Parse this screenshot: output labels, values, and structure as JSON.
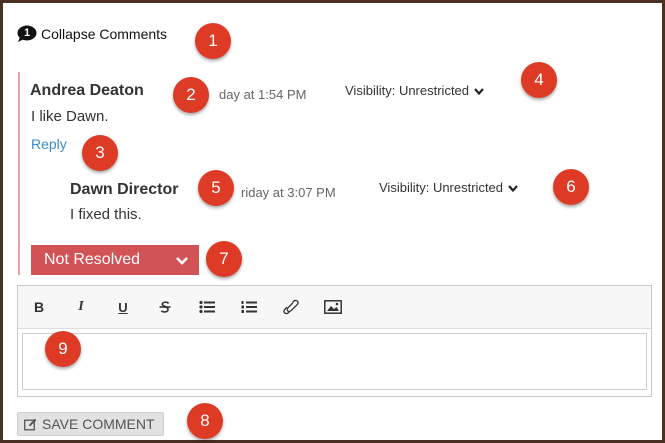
{
  "collapse": {
    "count": "1",
    "label": "Collapse Comments"
  },
  "comments": [
    {
      "author": "Andrea Deaton",
      "date": "day at 1:54 PM",
      "visibility": "Visibility: Unrestricted",
      "body": "I like Dawn.",
      "reply": "Reply"
    },
    {
      "author": "Dawn Director",
      "date": "riday at 3:07 PM",
      "visibility": "Visibility: Unrestricted",
      "body": "I fixed this."
    }
  ],
  "status": {
    "label": "Not Resolved"
  },
  "editor": {
    "toolbar": [
      {
        "name": "bold",
        "label": "B"
      },
      {
        "name": "italic",
        "label": "I"
      },
      {
        "name": "underline",
        "label": "U"
      },
      {
        "name": "strikethrough-icon"
      },
      {
        "name": "bullet-list-icon"
      },
      {
        "name": "numbered-list-icon"
      },
      {
        "name": "link-icon"
      },
      {
        "name": "image-icon"
      }
    ]
  },
  "save": {
    "label": "SAVE COMMENT"
  },
  "callouts": [
    "1",
    "2",
    "3",
    "4",
    "5",
    "6",
    "7",
    "8",
    "9"
  ],
  "colors": {
    "status_red": "#d25355",
    "callout_red": "#dd3b26",
    "link_blue": "#3a8bd2",
    "thread_line": "#e8a3a8",
    "frame": "#4a2f23"
  }
}
